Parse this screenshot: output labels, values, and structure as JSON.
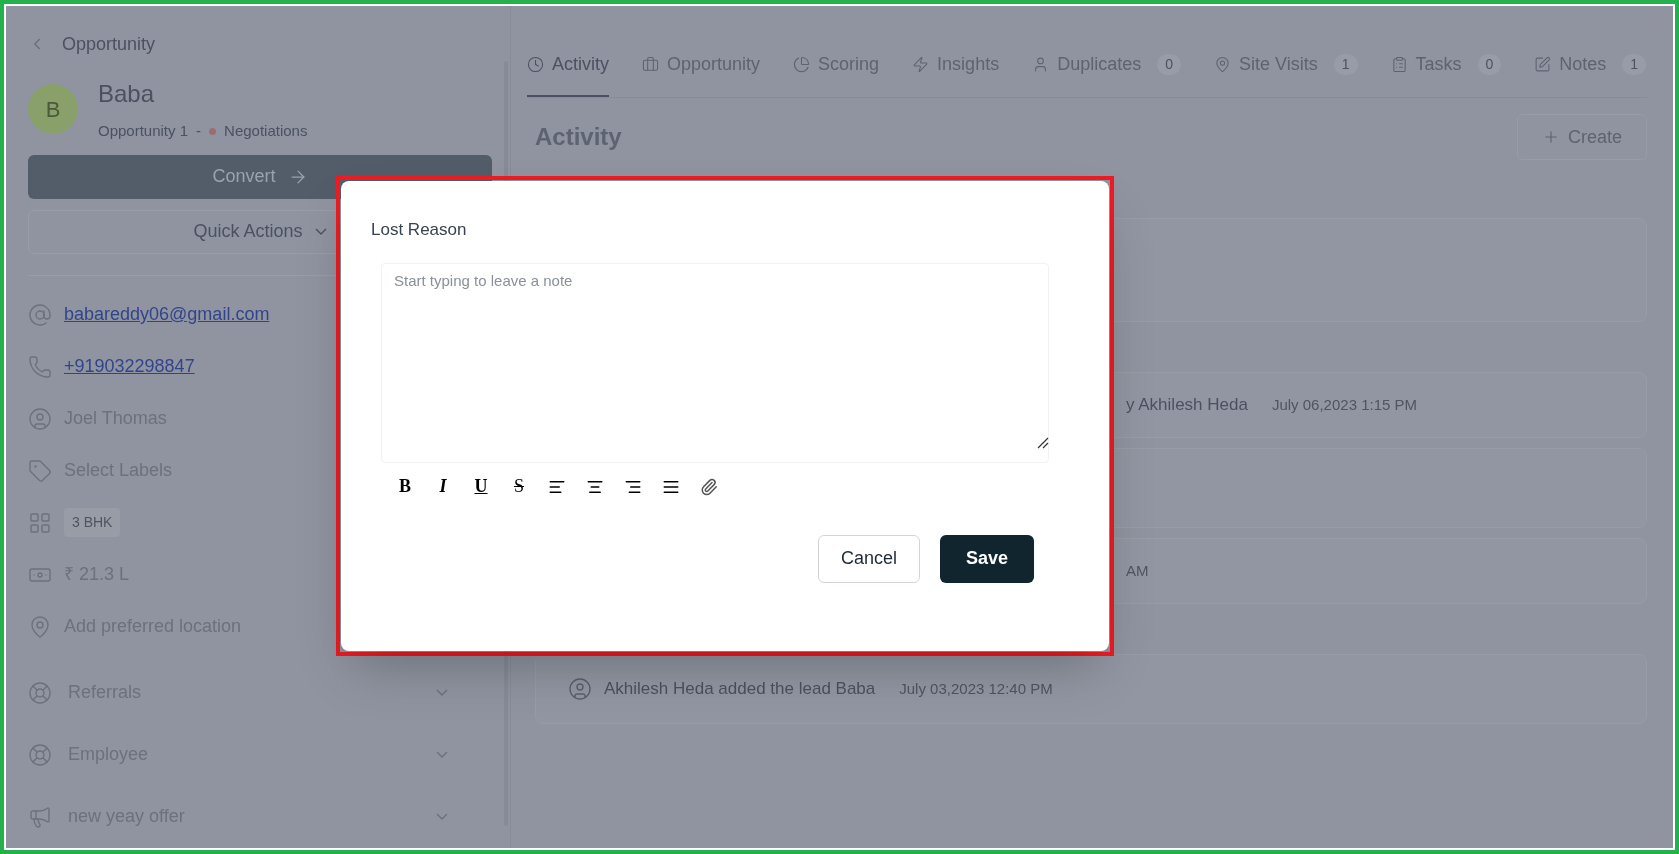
{
  "header": {
    "back_label": "Opportunity"
  },
  "lead": {
    "avatar": "B",
    "name": "Baba",
    "opportunity": "Opportunity 1",
    "separator": "-",
    "stage": "Negotiations"
  },
  "convert_button": "Convert",
  "quick_actions": "Quick Actions",
  "details": [
    {
      "kind": "email",
      "text": "babareddy06@gmail.com"
    },
    {
      "kind": "phone",
      "text": "+919032298847"
    },
    {
      "kind": "person",
      "text": "Joel Thomas"
    },
    {
      "kind": "labels",
      "text": "Select Labels"
    },
    {
      "kind": "chip",
      "text": "3 BHK"
    },
    {
      "kind": "price",
      "text": "₹ 21.3 L"
    },
    {
      "kind": "location",
      "text": "Add preferred location"
    }
  ],
  "sections": [
    {
      "kind": "referral",
      "label": "Referrals",
      "expanded": false
    },
    {
      "kind": "referral",
      "label": "Employee",
      "expanded": false
    },
    {
      "kind": "campaign",
      "label": "new yeay offer",
      "expanded": false
    }
  ],
  "tabs": [
    {
      "kind": "clock",
      "label": "Activity",
      "selected": true
    },
    {
      "kind": "briefcase",
      "label": "Opportunity",
      "selected": false
    },
    {
      "kind": "pie",
      "label": "Scoring",
      "selected": false
    },
    {
      "kind": "bolt",
      "label": "Insights",
      "selected": false
    },
    {
      "kind": "user",
      "label": "Duplicates",
      "count": "0",
      "selected": false
    },
    {
      "kind": "pin",
      "label": "Site Visits",
      "count": "1",
      "selected": false
    },
    {
      "kind": "clipboard",
      "label": "Tasks",
      "count": "0",
      "selected": false
    },
    {
      "kind": "pencil",
      "label": "Notes",
      "count": "1",
      "selected": false
    }
  ],
  "activity": {
    "title": "Activity",
    "create_button": "Create",
    "groups": [
      [
        {
          "kind": "blank"
        }
      ],
      [
        {
          "kind": "partial",
          "text": "y Akhilesh Heda",
          "time": "July 06,2023 1:15 PM"
        },
        {
          "kind": "blank"
        },
        {
          "kind": "partial",
          "time": "AM"
        }
      ],
      [
        {
          "kind": "full",
          "text": "Akhilesh Heda added the lead Baba",
          "time": "July 03,2023 12:40 PM"
        }
      ]
    ]
  },
  "dialog": {
    "title": "Lost Reason",
    "placeholder": "Start typing to leave a note",
    "toolbar": [
      {
        "kind": "bold",
        "label": "B"
      },
      {
        "kind": "italic",
        "label": "I"
      },
      {
        "kind": "underline",
        "label": "U"
      },
      {
        "kind": "strike",
        "label": "S"
      },
      {
        "kind": "align-left"
      },
      {
        "kind": "align-center"
      },
      {
        "kind": "align-right"
      },
      {
        "kind": "justify"
      },
      {
        "kind": "attach"
      }
    ],
    "buttons": [
      {
        "kind": "secondary",
        "label": "Cancel"
      },
      {
        "kind": "primary",
        "label": "Save"
      }
    ]
  }
}
